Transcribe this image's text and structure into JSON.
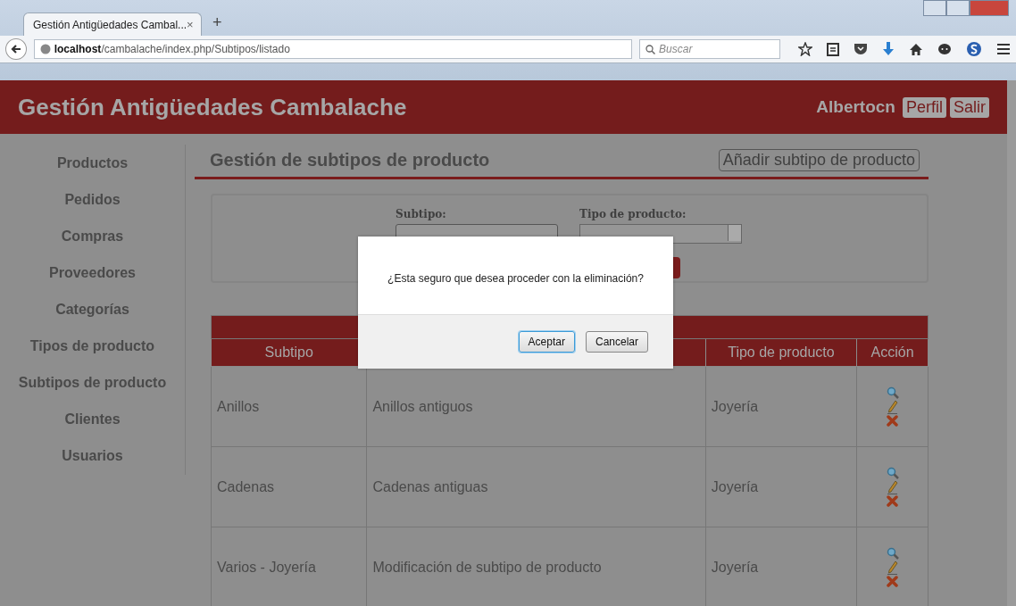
{
  "browser": {
    "tab_title": "Gestión Antigüedades Cambal...",
    "tab_close": "×",
    "new_tab": "+",
    "url_host": "localhost",
    "url_path": "/cambalache/index.php/Subtipos/listado",
    "search_placeholder": "Buscar"
  },
  "header": {
    "title": "Gestión Antigüedades Cambalache",
    "user": "Albertocn",
    "buttons": [
      "Perfil",
      "Salir"
    ]
  },
  "sidebar": {
    "items": [
      "Productos",
      "Pedidos",
      "Compras",
      "Proveedores",
      "Categorías",
      "Tipos de producto",
      "Subtipos de producto",
      "Clientes",
      "Usuarios"
    ]
  },
  "page": {
    "title": "Gestión de subtipos de producto",
    "add_button": "Añadir subtipo de producto"
  },
  "filter": {
    "subtipo_label": "Subtipo:",
    "tipo_label": "Tipo de producto:"
  },
  "table": {
    "columns": [
      "Subtipo",
      null,
      "Tipo de producto",
      "Acción"
    ],
    "rows": [
      {
        "subtipo": "Anillos",
        "descripcion": "Anillos antiguos",
        "tipo": "Joyería"
      },
      {
        "subtipo": "Cadenas",
        "descripcion": "Cadenas antiguas",
        "tipo": "Joyería"
      },
      {
        "subtipo": "Varios - Joyería",
        "descripcion": "Modificación de subtipo de producto",
        "tipo": "Joyería"
      }
    ]
  },
  "dialog": {
    "message": "¿Esta seguro que desea proceder con la eliminación?",
    "buttons": [
      {
        "label": "Aceptar",
        "selected": true
      },
      {
        "label": "Cancelar",
        "selected": false
      }
    ]
  }
}
